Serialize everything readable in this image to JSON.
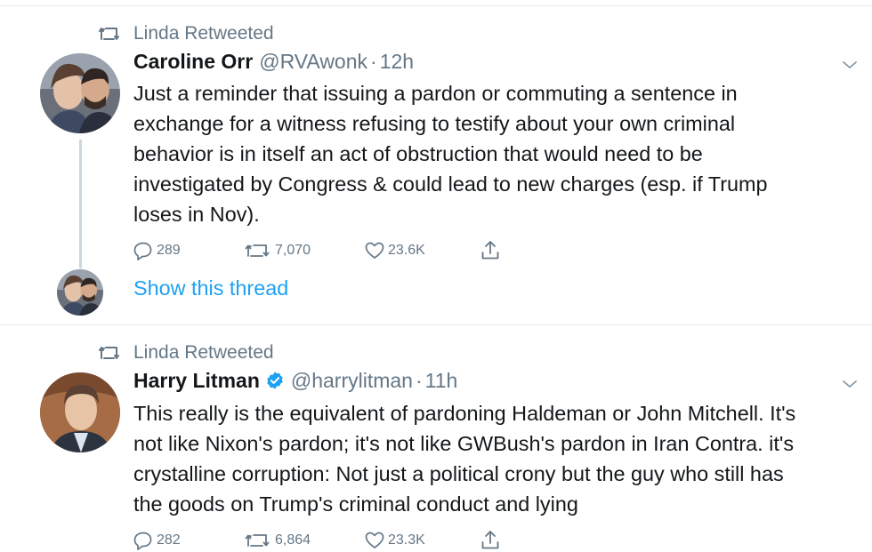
{
  "colors": {
    "accent": "#1da1f2",
    "secondary_text": "#657786",
    "divider": "#e6ecf0"
  },
  "tweets": [
    {
      "retweeted_by": "Linda Retweeted",
      "author_name": "Caroline Orr",
      "handle": "@RVAwonk",
      "time": "12h",
      "body_lines": [
        "Just a reminder that issuing a pardon or commuting a sentence in",
        "exchange for a witness refusing to testify about your own criminal",
        "behavior is in itself an act of obstruction that would need to be",
        "investigated by Congress & could lead to new charges (esp. if Trump",
        "loses in Nov)."
      ],
      "replies": "289",
      "retweets": "7,070",
      "likes": "23.6K",
      "show_thread": "Show this thread"
    },
    {
      "retweeted_by": "Linda Retweeted",
      "author_name": "Harry Litman",
      "handle": "@harrylitman",
      "time": "11h",
      "body_lines": [
        "This really is the equivalent of pardoning Haldeman or John Mitchell.  It's",
        "not like Nixon's pardon; it's not like GWBush's pardon in Iran Contra.  it's",
        "crystalline corruption:  Not just a political crony but the guy who still has",
        "the goods on Trump's criminal conduct and lying"
      ],
      "replies": "282",
      "retweets": "6,864",
      "likes": "23.3K"
    }
  ],
  "icons": [
    "retweet-icon",
    "reply-icon",
    "like-icon",
    "share-icon",
    "chevron-down-icon",
    "verified-badge-icon"
  ]
}
